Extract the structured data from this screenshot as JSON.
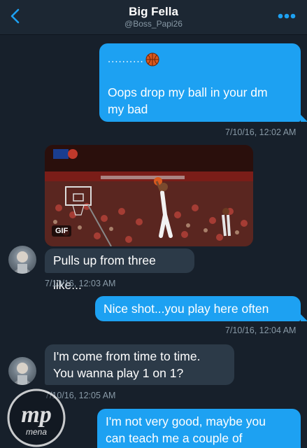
{
  "header": {
    "title": "Big Fella",
    "subtitle": "@Boss_Papi26",
    "back_icon": "chevron-left-icon",
    "more_icon": "more-dots-icon",
    "accent": "#1da1f2"
  },
  "messages": [
    {
      "dir": "out",
      "lines": [
        "..........",
        "Oops drop my ball in your dm",
        "my bad"
      ],
      "timestamp": "7/10/16, 12:02 AM"
    },
    {
      "dir": "in",
      "gif_badge": "GIF",
      "text": "Pulls up from three like...",
      "timestamp": "7/10/16, 12:03 AM"
    },
    {
      "dir": "out",
      "text": "Nice shot...you play here often",
      "timestamp": "7/10/16, 12:04 AM"
    },
    {
      "dir": "in",
      "lines": [
        "I'm come from time to time.",
        "You wanna play 1 on 1?"
      ],
      "timestamp": "7/10/16, 12:05 AM"
    },
    {
      "dir": "out",
      "lines": [
        "I'm not very good, maybe you",
        "can teach me a couple of"
      ]
    }
  ],
  "watermark": {
    "logo_text": "mp",
    "brand": "mena"
  }
}
